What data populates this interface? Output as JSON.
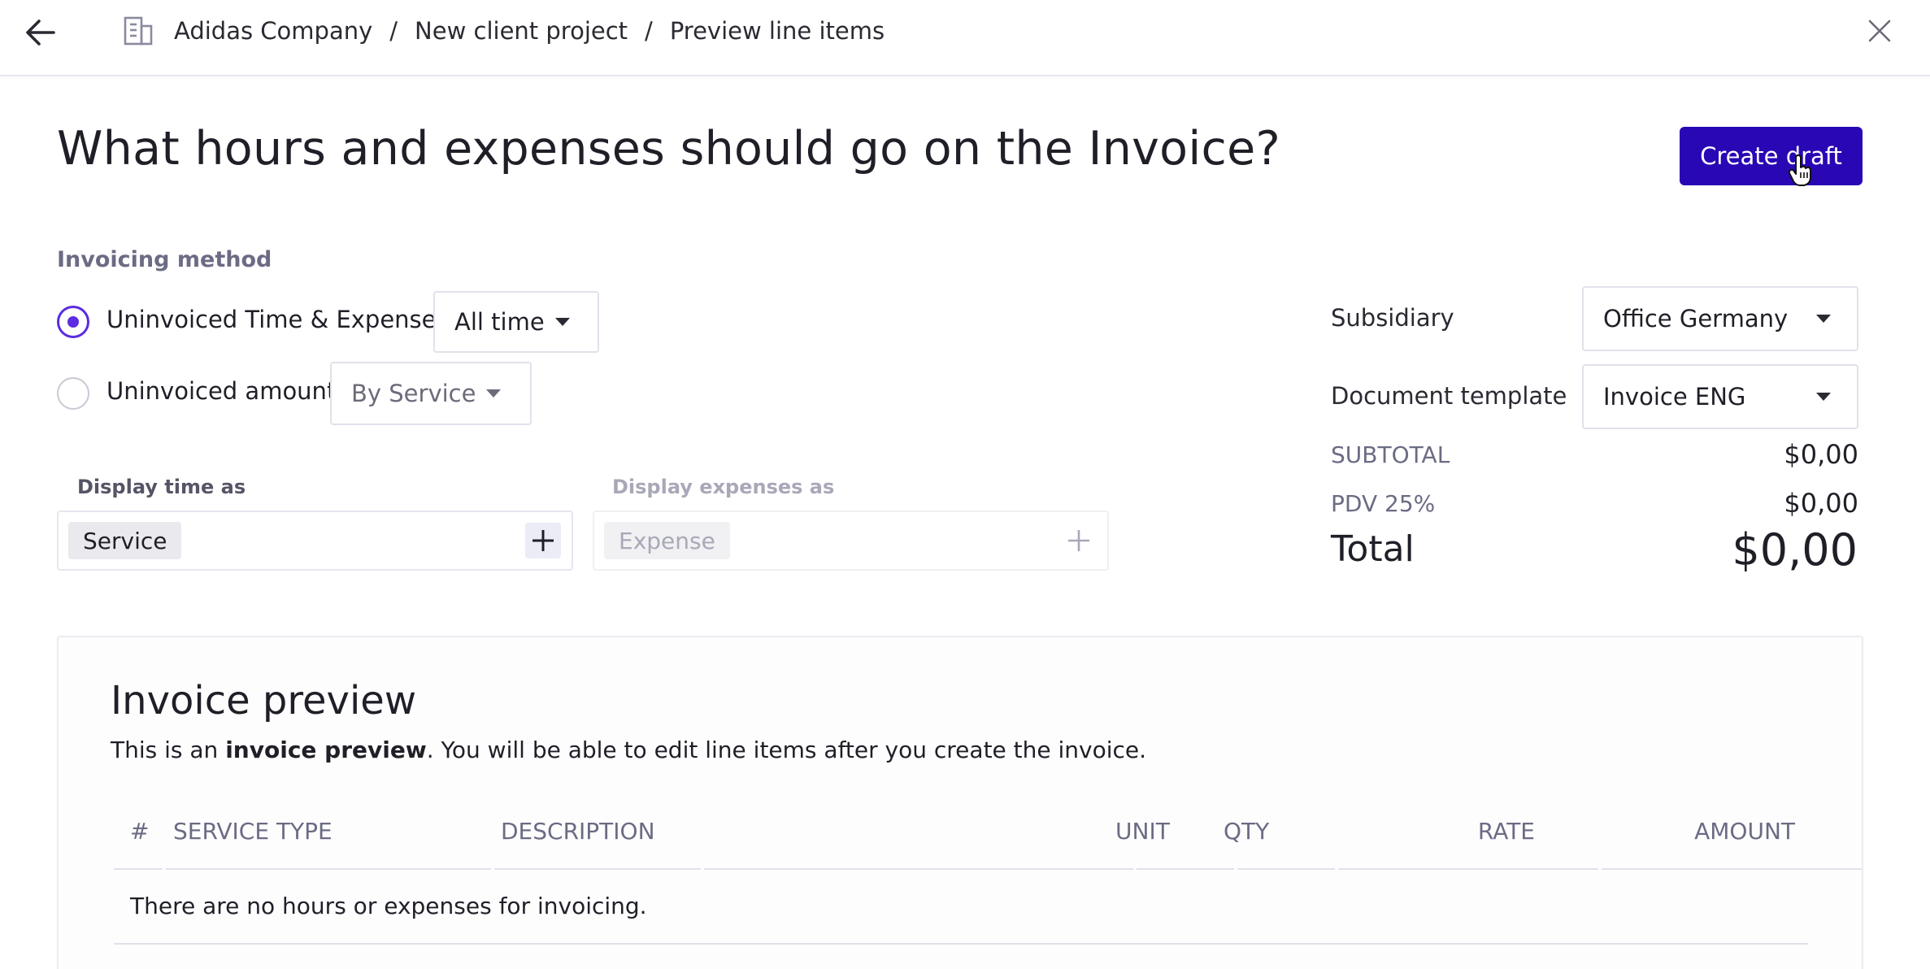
{
  "breadcrumb": {
    "items": [
      "Adidas Company",
      "New client project",
      "Preview line items"
    ],
    "separator": "/"
  },
  "header": {
    "title": "What hours and expenses should go on the Invoice?",
    "create_draft_label": "Create draft"
  },
  "invoicing": {
    "section_label": "Invoicing method",
    "option1_label": "Uninvoiced Time & Expenses",
    "option1_selected": true,
    "option1_period": "All time",
    "option2_label": "Uninvoiced amount",
    "option2_selected": false,
    "option2_grouping": "By Service"
  },
  "display": {
    "time_label": "Display time as",
    "time_tag": "Service",
    "expenses_label": "Display expenses as",
    "expenses_tag": "Expense"
  },
  "settings": {
    "subsidiary_label": "Subsidiary",
    "subsidiary_value": "Office Germany",
    "template_label": "Document template",
    "template_value": "Invoice ENG"
  },
  "summary": {
    "subtotal_label": "SUBTOTAL",
    "subtotal_value": "$0,00",
    "tax_label": "PDV 25%",
    "tax_value": "$0,00",
    "total_label": "Total",
    "total_value": "$0,00"
  },
  "preview": {
    "title": "Invoice preview",
    "desc_prefix": "This is an ",
    "desc_bold": "invoice preview",
    "desc_suffix": ". You will be able to edit line items after you create the invoice.",
    "columns": [
      "#",
      "SERVICE TYPE",
      "DESCRIPTION",
      "UNIT",
      "QTY",
      "RATE",
      "AMOUNT"
    ],
    "empty_message": "There are no hours or expenses for invoicing."
  },
  "colors": {
    "primary": "#2a07b4",
    "radio_accent": "#5b2ce0",
    "muted_text": "#6b6b84"
  },
  "icons": [
    "arrow-left-icon",
    "building-icon",
    "close-icon",
    "caret-down-icon",
    "plus-icon",
    "hand-pointer-icon"
  ]
}
